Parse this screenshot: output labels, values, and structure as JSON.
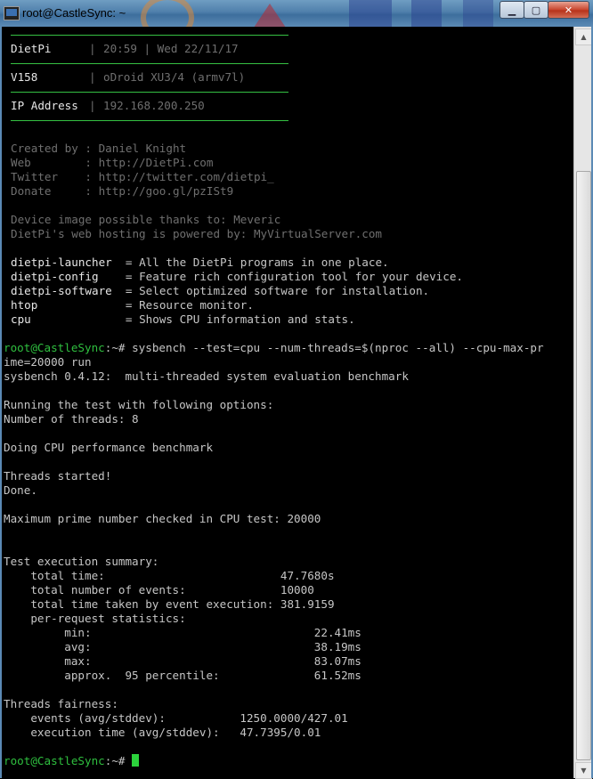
{
  "window": {
    "title": "root@CastleSync: ~",
    "minimize_glyph": "▁",
    "maximize_glyph": "▢",
    "close_glyph": "✕",
    "app_icon": "putty-terminal-icon"
  },
  "banner": {
    "row1": {
      "label": "DietPi",
      "sep": "|",
      "value": "20:59 | Wed 22/11/17"
    },
    "row2": {
      "label": "V158",
      "sep": "|",
      "value": "oDroid XU3/4 (armv7l)"
    },
    "row3": {
      "label": "IP Address",
      "sep": "|",
      "value": "192.168.200.250"
    }
  },
  "credits": [
    "Created by : Daniel Knight",
    "Web        : http://DietPi.com",
    "Twitter    : http://twitter.com/dietpi_",
    "Donate     : http://goo.gl/pzISt9"
  ],
  "thanks": [
    "Device image possible thanks to: Meveric",
    "DietPi's web hosting is powered by: MyVirtualServer.com"
  ],
  "commands": [
    {
      "name": "dietpi-launcher ",
      "desc": " = All the DietPi programs in one place."
    },
    {
      "name": "dietpi-config   ",
      "desc": " = Feature rich configuration tool for your device."
    },
    {
      "name": "dietpi-software ",
      "desc": " = Select optimized software for installation."
    },
    {
      "name": "htop            ",
      "desc": " = Resource monitor."
    },
    {
      "name": "cpu             ",
      "desc": " = Shows CPU information and stats."
    }
  ],
  "prompt": {
    "user_host": "root@CastleSync",
    "path": ":~",
    "symbol": "# ",
    "command": "sysbench --test=cpu --num-threads=$(nproc --all) --cpu-max-pr",
    "command_wrap": "ime=20000 run"
  },
  "output": [
    "sysbench 0.4.12:  multi-threaded system evaluation benchmark",
    "",
    "Running the test with following options:",
    "Number of threads: 8",
    "",
    "Doing CPU performance benchmark",
    "",
    "Threads started!",
    "Done.",
    "",
    "Maximum prime number checked in CPU test: 20000",
    "",
    "",
    "Test execution summary:",
    "    total time:                          47.7680s",
    "    total number of events:              10000",
    "    total time taken by event execution: 381.9159",
    "    per-request statistics:",
    "         min:                                 22.41ms",
    "         avg:                                 38.19ms",
    "         max:                                 83.07ms",
    "         approx.  95 percentile:              61.52ms",
    "",
    "Threads fairness:",
    "    events (avg/stddev):           1250.0000/427.01",
    "    execution time (avg/stddev):   47.7395/0.01",
    ""
  ],
  "final_prompt": {
    "user_host": "root@CastleSync",
    "path": ":~",
    "symbol": "# "
  },
  "scrollbar": {
    "up_glyph": "▲",
    "down_glyph": "▼"
  }
}
